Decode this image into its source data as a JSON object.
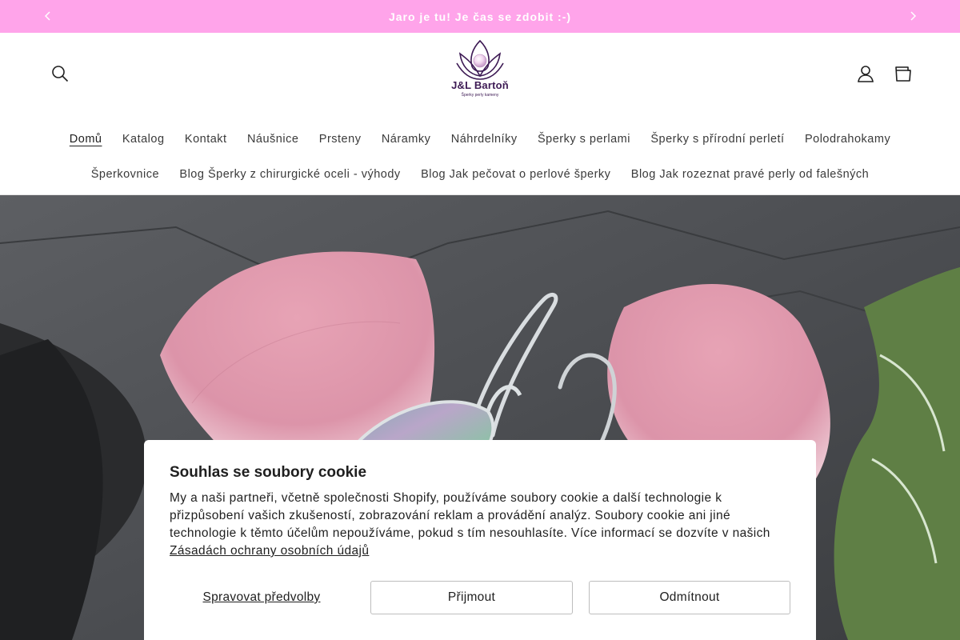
{
  "announcement": {
    "text": "Jaro je tu! Je čas se zdobit :-)",
    "prev_icon": "chevron-left-icon",
    "next_icon": "chevron-right-icon"
  },
  "header": {
    "logo_name": "J&L Bartoň",
    "logo_tagline": "Šperky perly kameny",
    "icons": [
      "search-icon",
      "account-icon",
      "cart-icon"
    ]
  },
  "nav": {
    "row1": [
      "Domů",
      "Katalog",
      "Kontakt",
      "Náušnice",
      "Prsteny",
      "Náramky",
      "Náhrdelníky",
      "Šperky s perlami",
      "Šperky s přírodní perletí",
      "Polodrahokamy"
    ],
    "row2": [
      "Šperkovnice",
      "Blog Šperky z chirurgické oceli - výhody",
      "Blog Jak pečovat o perlové šperky",
      "Blog Jak rozeznat pravé perly od falešných"
    ]
  },
  "cookie": {
    "title": "Souhlas se soubory cookie",
    "body": "My a naši partneři, včetně společnosti Shopify, používáme soubory cookie a další technologie k přizpůsobení vašich zkušeností, zobrazování reklam a provádění analýz. Soubory cookie ani jiné technologie k těmto účelům nepoužíváme, pokud s tím nesouhlasíte. Více informací se dozvíte v našich ",
    "link": "Zásadách ochrany osobních údajů",
    "manage_label": "Spravovat předvolby",
    "accept_label": "Přijmout",
    "decline_label": "Odmítnout"
  },
  "colors": {
    "announcement_bg": "#ffa4ea",
    "brand": "#3d1a54"
  }
}
